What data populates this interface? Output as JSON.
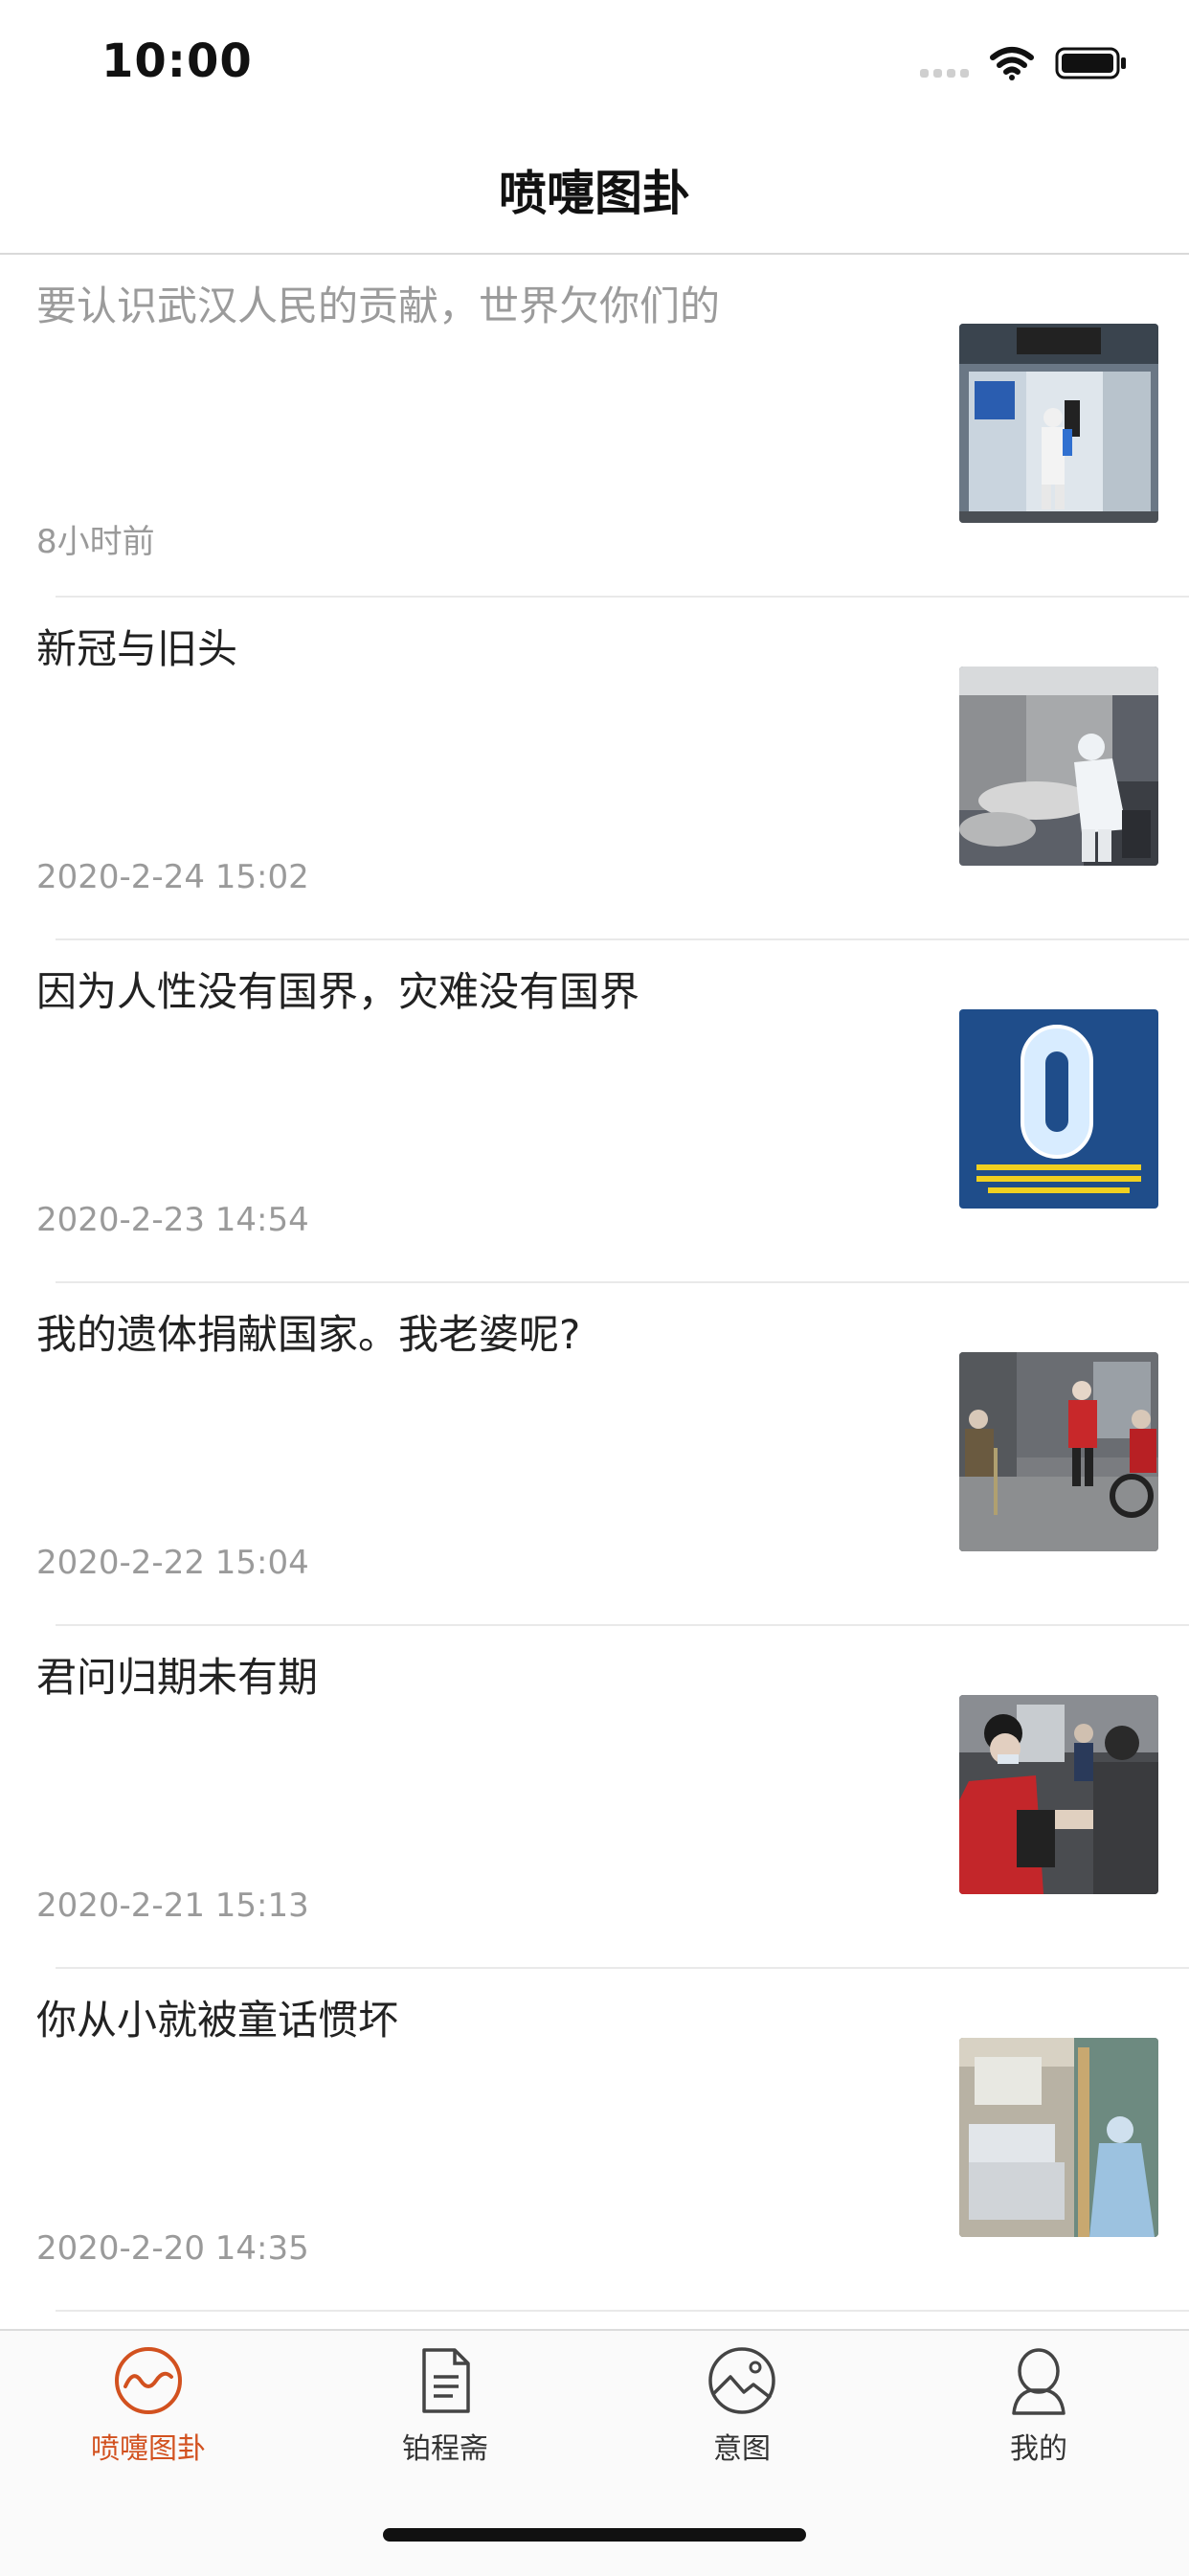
{
  "status_bar": {
    "time": "10:00"
  },
  "nav": {
    "title": "喷嚏图卦"
  },
  "feed": [
    {
      "title": "要认识武汉人民的贡献，世界欠你们的",
      "time": "8小时前",
      "read": true,
      "thumb": "hospital-door-disinfection"
    },
    {
      "title": "新冠与旧头",
      "time": "2020-2-24 15:02",
      "read": false,
      "thumb": "medic-with-patient"
    },
    {
      "title": "因为人性没有国界，灾难没有国界",
      "time": "2020-2-23 14:54",
      "read": false,
      "thumb": "zero-cases-poster"
    },
    {
      "title": "我的遗体捐献国家。我老婆呢?",
      "time": "2020-2-22 15:04",
      "read": false,
      "thumb": "street-checkpoint"
    },
    {
      "title": "君问归期未有期",
      "time": "2020-2-21 15:13",
      "read": false,
      "thumb": "people-in-masks"
    },
    {
      "title": "你从小就被童话惯坏",
      "time": "2020-2-20 14:35",
      "read": false,
      "thumb": "hospital-ward"
    }
  ],
  "tabs": [
    {
      "label": "喷嚏图卦",
      "icon": "wave-circle-icon",
      "active": true
    },
    {
      "label": "铂程斋",
      "icon": "document-icon",
      "active": false
    },
    {
      "label": "意图",
      "icon": "landscape-circle-icon",
      "active": false
    },
    {
      "label": "我的",
      "icon": "person-icon",
      "active": false
    }
  ],
  "colors": {
    "accent": "#d2511f",
    "text": "#222222",
    "muted": "#9a9a9a"
  }
}
